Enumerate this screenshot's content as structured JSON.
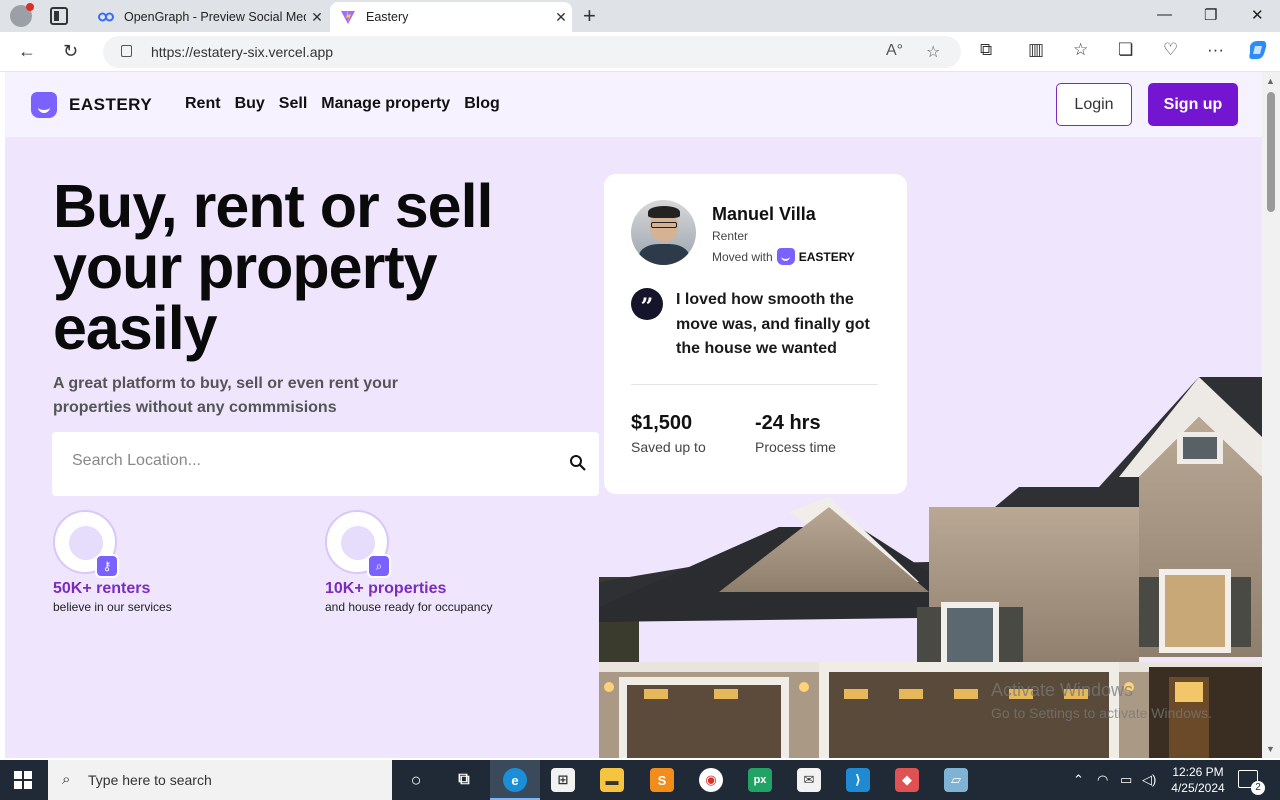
{
  "browser": {
    "tabs": [
      {
        "title": "OpenGraph - Preview Social Med",
        "active": false
      },
      {
        "title": "Eastery",
        "active": true
      }
    ],
    "url": "https://estatery-six.vercel.app"
  },
  "site": {
    "brand": "EASTERY",
    "menu": [
      "Rent",
      "Buy",
      "Sell",
      "Manage property",
      "Blog"
    ],
    "login_label": "Login",
    "signup_label": "Sign up",
    "accent_color": "#7415d1"
  },
  "hero": {
    "title": "Buy, rent or sell your property easily",
    "subtitle": "A great platform to buy, sell or even rent your properties without any commmisions",
    "search_placeholder": "Search Location...",
    "stats": [
      {
        "value": "50K+ renters",
        "label": "believe in our services"
      },
      {
        "value": "10K+ properties",
        "label": "and house ready for occupancy"
      }
    ]
  },
  "testimonial": {
    "name": "Manuel Villa",
    "role": "Renter",
    "moved_with": "Moved with",
    "brand": "EASTERY",
    "quote": "I loved how smooth the move was, and finally got the house we wanted",
    "metrics": [
      {
        "value": "$1,500",
        "label": "Saved up to"
      },
      {
        "value": "-24 hrs",
        "label": "Process time"
      }
    ]
  },
  "watermark": {
    "line1": "Activate Windows",
    "line2": "Go to Settings to activate Windows."
  },
  "taskbar": {
    "search_text": "Type here to search",
    "time": "12:26 PM",
    "date": "4/25/2024",
    "notifications": "2"
  }
}
